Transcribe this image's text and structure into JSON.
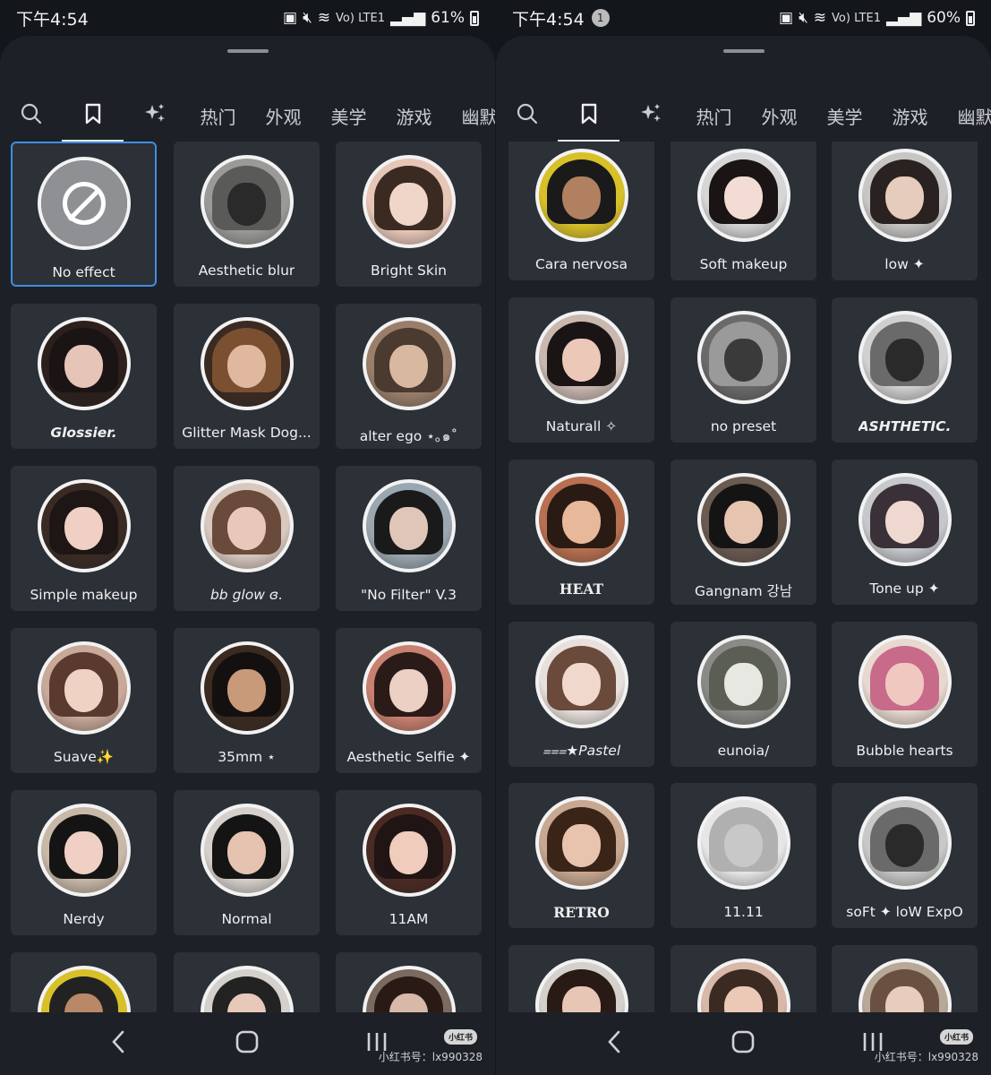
{
  "watermark_text": "小红书号：lx990328",
  "watermark_badge": "小红书",
  "panels": [
    {
      "status": {
        "time": "下午4:54",
        "notif_count": "",
        "lte": "Vo) LTE1",
        "battery": "61%"
      },
      "tabs": [
        "热门",
        "外观",
        "美学",
        "游戏",
        "幽默"
      ],
      "cards": [
        {
          "label": "No effect",
          "style": "",
          "colors": [
            "#8e9094",
            "#8e9094",
            "#8e9094"
          ]
        },
        {
          "label": "Aesthetic blur",
          "style": "",
          "colors": [
            "#9a9a98",
            "#2a2a2a",
            "#5a5a58"
          ]
        },
        {
          "label": "Bright Skin",
          "style": "",
          "colors": [
            "#e6c6b6",
            "#f0d6c8",
            "#3a2a22"
          ]
        },
        {
          "label": "Glossier.",
          "style": "bold",
          "colors": [
            "#2c1f1c",
            "#e7c4b8",
            "#1a1414"
          ]
        },
        {
          "label": "Glitter Mask Dog...",
          "style": "",
          "colors": [
            "#3a2a22",
            "#e0b8a0",
            "#7a5030"
          ]
        },
        {
          "label": "alter ego ⋆｡๑˚",
          "style": "",
          "colors": [
            "#9a7e6a",
            "#d9b8a0",
            "#4a3a30"
          ]
        },
        {
          "label": "Simple makeup",
          "style": "",
          "colors": [
            "#3a2a24",
            "#f0d0c4",
            "#1e1614"
          ]
        },
        {
          "label": "bb glow ɞ.",
          "style": "italic",
          "colors": [
            "#d8c8be",
            "#e8c8b8",
            "#6a4a3a"
          ]
        },
        {
          "label": "\"No Filter\" V.3",
          "style": "",
          "colors": [
            "#9aa6b0",
            "#e0c6b8",
            "#1a1a1a"
          ]
        },
        {
          "label": "Suave✨",
          "style": "",
          "colors": [
            "#c8a898",
            "#f0d2c4",
            "#5a3a2e"
          ]
        },
        {
          "label": "35mm ⋆",
          "style": "",
          "colors": [
            "#3a2a20",
            "#c89a7a",
            "#141010"
          ]
        },
        {
          "label": "Aesthetic Selfie ✦",
          "style": "",
          "colors": [
            "#c88070",
            "#ecd0c4",
            "#2a1a18"
          ]
        },
        {
          "label": "Nerdy",
          "style": "",
          "colors": [
            "#c8b8a8",
            "#f0d0c4",
            "#141414"
          ]
        },
        {
          "label": "Normal",
          "style": "",
          "colors": [
            "#d6d0cc",
            "#e6c2b0",
            "#141414"
          ]
        },
        {
          "label": "11AM",
          "style": "",
          "colors": [
            "#4a2a22",
            "#f0ccbc",
            "#201414"
          ]
        },
        {
          "label": "",
          "style": "",
          "colors": [
            "#d8c028",
            "#b88868",
            "#222"
          ]
        },
        {
          "label": "",
          "style": "",
          "colors": [
            "#d4d0cc",
            "#e8c8b8",
            "#222"
          ]
        },
        {
          "label": "",
          "style": "",
          "colors": [
            "#7a6a60",
            "#d8b8a8",
            "#2a1a16"
          ]
        }
      ]
    },
    {
      "status": {
        "time": "下午4:54",
        "notif_count": "1",
        "lte": "Vo) LTE1",
        "battery": "60%"
      },
      "tabs": [
        "热门",
        "外观",
        "美学",
        "游戏",
        "幽默"
      ],
      "cards": [
        {
          "label": "Cara nervosa",
          "style": "",
          "colors": [
            "#d8c028",
            "#b08060",
            "#1a1a1a"
          ]
        },
        {
          "label": "Soft makeup",
          "style": "",
          "colors": [
            "#d6d6d6",
            "#f2dcd4",
            "#1a1414"
          ]
        },
        {
          "label": "low ✦",
          "style": "",
          "colors": [
            "#c8c6c4",
            "#e6ccbc",
            "#2a2220"
          ]
        },
        {
          "label": "Naturall ✧",
          "style": "",
          "colors": [
            "#c8b8b0",
            "#ecc8b8",
            "#1a1414"
          ]
        },
        {
          "label": "no preset",
          "style": "",
          "colors": [
            "#6a6a6a",
            "#3a3a3a",
            "#9a9a9a"
          ]
        },
        {
          "label": "ASHTHETIC.",
          "style": "bold",
          "colors": [
            "#d0d0d0",
            "#2a2a2a",
            "#6a6a6a"
          ]
        },
        {
          "label": "HEAT",
          "style": "serif",
          "colors": [
            "#b87050",
            "#e8b89a",
            "#2a1a14"
          ]
        },
        {
          "label": "Gangnam 강남",
          "style": "",
          "colors": [
            "#6a5a50",
            "#e6c4b0",
            "#141414"
          ]
        },
        {
          "label": "Tone up ✦",
          "style": "",
          "colors": [
            "#c6c8cc",
            "#eed8d0",
            "#3a3038"
          ]
        },
        {
          "label": "⩶★Pastel",
          "style": "italic",
          "colors": [
            "#e8e0dc",
            "#f0d8cc",
            "#6a4a3a"
          ]
        },
        {
          "label": "eunoia/",
          "style": "",
          "colors": [
            "#8a8a86",
            "#e8e8e2",
            "#5a5e54"
          ]
        },
        {
          "label": "Bubble hearts",
          "style": "",
          "colors": [
            "#e8d8d0",
            "#f0c8c0",
            "#c86a8a"
          ]
        },
        {
          "label": "RETRO",
          "style": "serif",
          "colors": [
            "#c8a890",
            "#e8c4ae",
            "#3a2418"
          ]
        },
        {
          "label": "11.11",
          "style": "",
          "colors": [
            "#e6e6e6",
            "#c8c8c8",
            "#b0b0b0"
          ]
        },
        {
          "label": "soFt ✦ loW ExpO",
          "style": "",
          "colors": [
            "#c8c8c6",
            "#2a2a2a",
            "#6a6a6a"
          ]
        },
        {
          "label": "",
          "style": "",
          "colors": [
            "#d4d0cc",
            "#e8c6b6",
            "#2a1a16"
          ]
        },
        {
          "label": "",
          "style": "",
          "colors": [
            "#d8b8a8",
            "#ecc8b6",
            "#3a2a22"
          ]
        },
        {
          "label": "",
          "style": "",
          "colors": [
            "#b8a898",
            "#e8ccbc",
            "#6a5040"
          ]
        }
      ]
    }
  ],
  "nav": {
    "back_icon": "back-icon",
    "home_icon": "home-icon",
    "recents_icon": "recents-icon"
  }
}
